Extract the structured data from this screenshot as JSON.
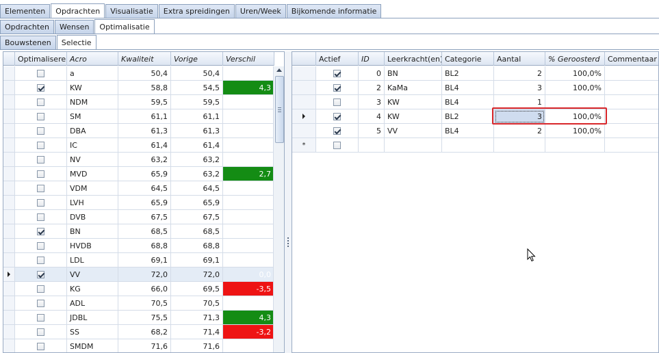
{
  "tabs_level1": [
    {
      "label": "Elementen"
    },
    {
      "label": "Opdrachten"
    },
    {
      "label": "Visualisatie"
    },
    {
      "label": "Extra spreidingen"
    },
    {
      "label": "Uren/Week"
    },
    {
      "label": "Bijkomende informatie"
    }
  ],
  "tabs_level2": [
    {
      "label": "Opdrachten"
    },
    {
      "label": "Wensen"
    },
    {
      "label": "Optimalisatie"
    }
  ],
  "tabs_level3": [
    {
      "label": "Bouwstenen"
    },
    {
      "label": "Selectie"
    }
  ],
  "left_grid": {
    "columns": [
      "Optimaliseren",
      "Acro",
      "Kwaliteit",
      "Vorige",
      "Verschil"
    ],
    "rows": [
      {
        "checked": false,
        "acro": "a",
        "kwaliteit": "50,4",
        "vorige": "50,4",
        "verschil": "",
        "tone": ""
      },
      {
        "checked": true,
        "acro": "KW",
        "kwaliteit": "58,8",
        "vorige": "54,5",
        "verschil": "4,3",
        "tone": "pos"
      },
      {
        "checked": false,
        "acro": "NDM",
        "kwaliteit": "59,5",
        "vorige": "59,5",
        "verschil": "",
        "tone": ""
      },
      {
        "checked": false,
        "acro": "SM",
        "kwaliteit": "61,1",
        "vorige": "61,1",
        "verschil": "",
        "tone": ""
      },
      {
        "checked": false,
        "acro": "DBA",
        "kwaliteit": "61,3",
        "vorige": "61,3",
        "verschil": "",
        "tone": ""
      },
      {
        "checked": false,
        "acro": "IC",
        "kwaliteit": "61,4",
        "vorige": "61,4",
        "verschil": "",
        "tone": ""
      },
      {
        "checked": false,
        "acro": "NV",
        "kwaliteit": "63,2",
        "vorige": "63,2",
        "verschil": "",
        "tone": ""
      },
      {
        "checked": false,
        "acro": "MVD",
        "kwaliteit": "65,9",
        "vorige": "63,2",
        "verschil": "2,7",
        "tone": "pos"
      },
      {
        "checked": false,
        "acro": "VDM",
        "kwaliteit": "64,5",
        "vorige": "64,5",
        "verschil": "",
        "tone": ""
      },
      {
        "checked": false,
        "acro": "LVH",
        "kwaliteit": "65,9",
        "vorige": "65,9",
        "verschil": "",
        "tone": ""
      },
      {
        "checked": false,
        "acro": "DVB",
        "kwaliteit": "67,5",
        "vorige": "67,5",
        "verschil": "",
        "tone": ""
      },
      {
        "checked": true,
        "acro": "BN",
        "kwaliteit": "68,5",
        "vorige": "68,5",
        "verschil": "",
        "tone": ""
      },
      {
        "checked": false,
        "acro": "HVDB",
        "kwaliteit": "68,8",
        "vorige": "68,8",
        "verschil": "",
        "tone": ""
      },
      {
        "checked": false,
        "acro": "LDL",
        "kwaliteit": "69,1",
        "vorige": "69,1",
        "verschil": "",
        "tone": ""
      },
      {
        "checked": true,
        "acro": "VV",
        "kwaliteit": "72,0",
        "vorige": "72,0",
        "verschil": "0,0",
        "tone": "zero",
        "current": true
      },
      {
        "checked": false,
        "acro": "KG",
        "kwaliteit": "66,0",
        "vorige": "69,5",
        "verschil": "-3,5",
        "tone": "neg"
      },
      {
        "checked": false,
        "acro": "ADL",
        "kwaliteit": "70,5",
        "vorige": "70,5",
        "verschil": "",
        "tone": ""
      },
      {
        "checked": false,
        "acro": "JDBL",
        "kwaliteit": "75,5",
        "vorige": "71,3",
        "verschil": "4,3",
        "tone": "pos"
      },
      {
        "checked": false,
        "acro": "SS",
        "kwaliteit": "68,2",
        "vorige": "71,4",
        "verschil": "-3,2",
        "tone": "neg"
      },
      {
        "checked": false,
        "acro": "SMDM",
        "kwaliteit": "71,6",
        "vorige": "71,6",
        "verschil": "",
        "tone": ""
      }
    ]
  },
  "right_grid": {
    "columns": [
      "Actief",
      "ID",
      "Leerkracht(en)",
      "Categorie",
      "Aantal",
      "% Geroosterd",
      "Commentaar"
    ],
    "rows": [
      {
        "actief": true,
        "id": "0",
        "leerkracht": "BN",
        "categorie": "BL2",
        "aantal": "2",
        "geroosterd": "100,0%",
        "commentaar": ""
      },
      {
        "actief": true,
        "id": "2",
        "leerkracht": "KaMa",
        "categorie": "BL4",
        "aantal": "3",
        "geroosterd": "100,0%",
        "commentaar": ""
      },
      {
        "actief": false,
        "id": "3",
        "leerkracht": "KW",
        "categorie": "BL4",
        "aantal": "1",
        "geroosterd": "",
        "commentaar": ""
      },
      {
        "actief": true,
        "id": "4",
        "leerkracht": "KW",
        "categorie": "BL2",
        "aantal": "3",
        "geroosterd": "100,0%",
        "commentaar": "",
        "current": true
      },
      {
        "actief": true,
        "id": "5",
        "leerkracht": "VV",
        "categorie": "BL4",
        "aantal": "2",
        "geroosterd": "100,0%",
        "commentaar": ""
      }
    ],
    "new_row_marker": "*"
  },
  "colors": {
    "positive": "#148c14",
    "negative": "#ee1414",
    "highlight": "#d8262a"
  },
  "icons": {
    "current_row": "triangle-right-icon",
    "new_row": "asterisk-icon",
    "cursor": "mouse-pointer-icon"
  }
}
